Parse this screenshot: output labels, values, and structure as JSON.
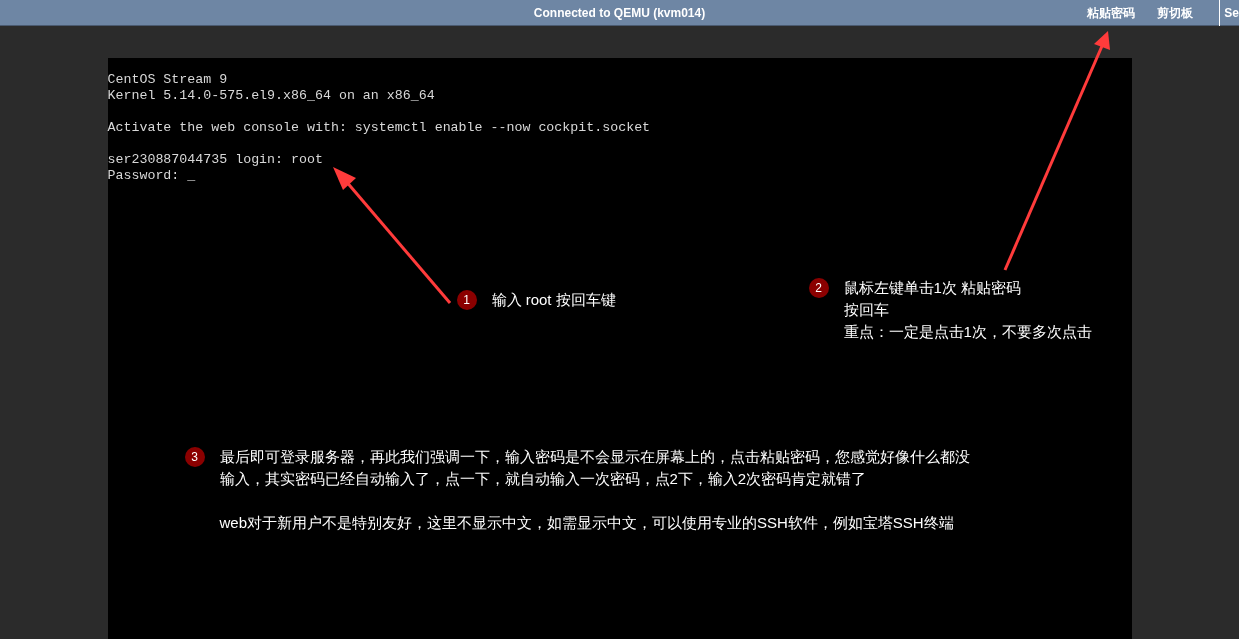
{
  "top_bar": {
    "title": "Connected to QEMU (kvm014)",
    "buttons": [
      "粘贴密码",
      "剪切板"
    ],
    "cut_button": "Se"
  },
  "console": {
    "blocks": [
      [
        "CentOS Stream 9",
        "Kernel 5.14.0-575.el9.x86_64 on an x86_64"
      ],
      [
        "Activate the web console with: systemctl enable --now cockpit.socket"
      ],
      [
        "ser230887044735 login: root",
        "Password: _"
      ]
    ]
  },
  "annotations": [
    {
      "number": "1",
      "paragraphs": [
        [
          "输入 root 按回车键"
        ]
      ]
    },
    {
      "number": "2",
      "paragraphs": [
        [
          "鼠标左键单击1次 粘贴密码",
          "按回车",
          "重点：一定是点击1次，不要多次点击"
        ]
      ]
    },
    {
      "number": "3",
      "paragraphs": [
        [
          "最后即可登录服务器，再此我们强调一下，输入密码是不会显示在屏幕上的，点击粘贴密码，您感觉好像什么都没",
          "输入，其实密码已经自动输入了，点一下，就自动输入一次密码，点2下，输入2次密码肯定就错了"
        ],
        [
          "web对于新用户不是特别友好，这里不显示中文，如需显示中文，可以使用专业的SSH软件，例如宝塔SSH终端"
        ]
      ]
    }
  ]
}
